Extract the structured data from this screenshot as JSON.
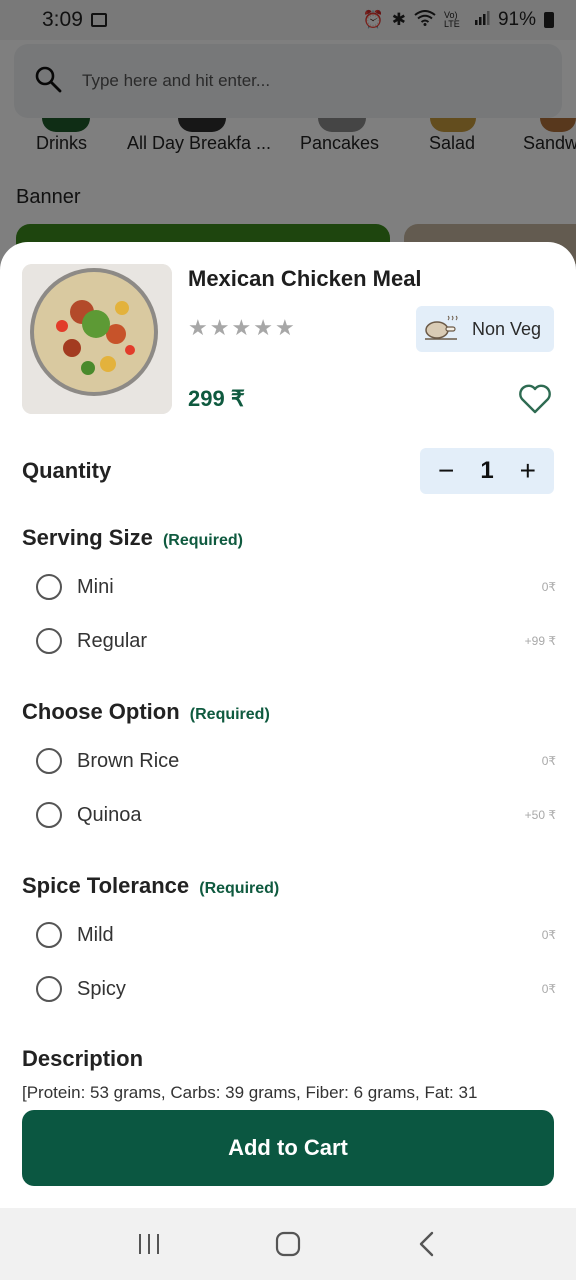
{
  "status_bar": {
    "time": "3:09",
    "battery": "91%",
    "network_label": "Vo) LTE"
  },
  "search": {
    "placeholder": "Type here and hit enter..."
  },
  "categories": [
    "Drinks",
    "All Day Breakfa ...",
    "Pancakes",
    "Salad",
    "Sandw"
  ],
  "banner_label": "Banner",
  "product": {
    "title": "Mexican Chicken Meal",
    "rating": 0,
    "rating_max": 5,
    "price": "299 ₹",
    "diet_label": "Non Veg"
  },
  "quantity": {
    "label": "Quantity",
    "value": "1",
    "minus": "−",
    "plus": "+"
  },
  "required_tag": "(Required)",
  "sections": [
    {
      "title": "Serving Size",
      "options": [
        {
          "label": "Mini",
          "price": "0₹"
        },
        {
          "label": "Regular",
          "price": "+99 ₹"
        }
      ]
    },
    {
      "title": "Choose Option",
      "options": [
        {
          "label": "Brown Rice",
          "price": "0₹"
        },
        {
          "label": "Quinoa",
          "price": "+50 ₹"
        }
      ]
    },
    {
      "title": "Spice Tolerance",
      "options": [
        {
          "label": "Mild",
          "price": "0₹"
        },
        {
          "label": "Spicy",
          "price": "0₹"
        }
      ]
    }
  ],
  "description": {
    "title": "Description",
    "text": "[Protein: 53 grams, Carbs: 39 grams, Fiber: 6 grams, Fat: 31"
  },
  "cta": {
    "label": "Add to Cart"
  },
  "colors": {
    "primary": "#0b5741",
    "chip_bg": "#e3eef9",
    "required": "#0f5a3f"
  },
  "icons": {
    "search": "search-icon",
    "heart": "heart-icon",
    "chicken": "chicken-leg-icon",
    "nav_recents": "recents-icon",
    "nav_home": "home-icon",
    "nav_back": "back-icon"
  }
}
